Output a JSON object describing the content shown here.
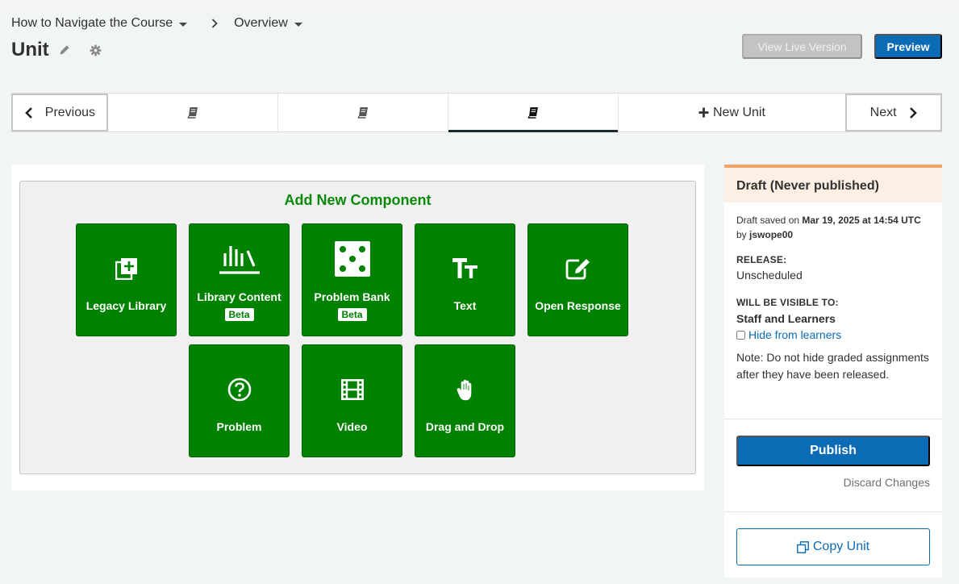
{
  "breadcrumb": {
    "section": "How to Navigate the Course",
    "subsection": "Overview"
  },
  "unit": {
    "title": "Unit"
  },
  "header": {
    "view_live_label": "View Live Version",
    "preview_label": "Preview"
  },
  "sequence": {
    "previous_label": "Previous",
    "next_label": "Next",
    "new_unit_label": "New Unit",
    "tabs": [
      {
        "icon": "book-icon",
        "active": false
      },
      {
        "icon": "book-icon",
        "active": false
      },
      {
        "icon": "book-icon",
        "active": true
      }
    ]
  },
  "add_component": {
    "title": "Add New Component",
    "components": [
      {
        "label": "Legacy Library",
        "icon": "library-add-icon",
        "beta": ""
      },
      {
        "label": "Library Content",
        "icon": "library-books-icon",
        "beta": "Beta"
      },
      {
        "label": "Problem Bank",
        "icon": "dice-icon",
        "beta": "Beta"
      },
      {
        "label": "Text",
        "icon": "text-format-icon",
        "beta": ""
      },
      {
        "label": "Open Response",
        "icon": "edit-square-icon",
        "beta": ""
      },
      {
        "label": "Problem",
        "icon": "help-circle-icon",
        "beta": ""
      },
      {
        "label": "Video",
        "icon": "film-icon",
        "beta": ""
      },
      {
        "label": "Drag and Drop",
        "icon": "hand-icon",
        "beta": ""
      }
    ]
  },
  "status": {
    "heading": "Draft (Never published)",
    "saved_prefix": "Draft saved on",
    "saved_date": "Mar 19, 2025 at 14:54 UTC",
    "by_prefix": "by",
    "author": "jswope00",
    "release_label": "RELEASE:",
    "release_value": "Unscheduled",
    "visible_label": "WILL BE VISIBLE TO:",
    "visible_value": "Staff and Learners",
    "hide_label": "Hide from learners",
    "hide_checked": false,
    "note": "Note: Do not hide graded assignments after they have been released.",
    "publish_label": "Publish",
    "discard_label": "Discard Changes",
    "copy_label": "Copy Unit"
  },
  "colors": {
    "brand_blue": "#0b6bb5",
    "component_green": "#008100",
    "draft_accent": "#f0a46a"
  }
}
